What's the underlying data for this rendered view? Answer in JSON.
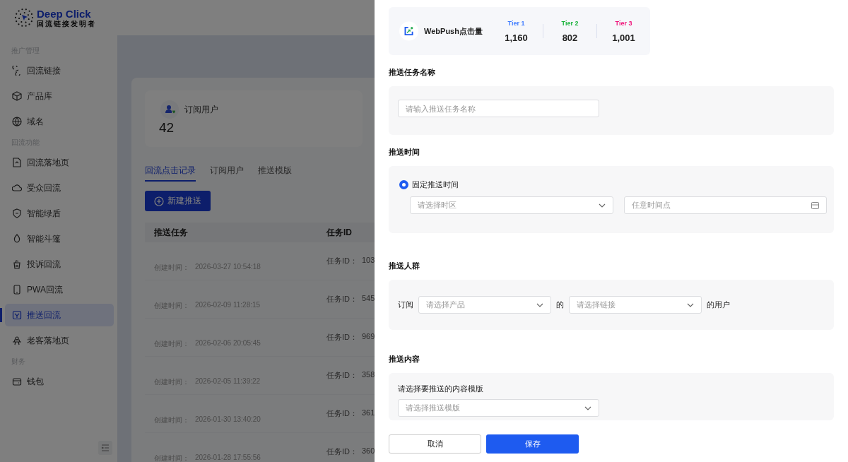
{
  "logo": {
    "name": "Deep Click",
    "tagline": "回流链接发明者"
  },
  "sidebar": {
    "sections": [
      {
        "title": "推广管理",
        "items": [
          {
            "label": "回流链接",
            "selected": false
          },
          {
            "label": "产品库",
            "selected": false
          },
          {
            "label": "域名",
            "selected": false
          }
        ]
      },
      {
        "title": "回流功能",
        "items": [
          {
            "label": "回流落地页",
            "selected": false
          },
          {
            "label": "受众回流",
            "selected": false
          },
          {
            "label": "智能绿盾",
            "selected": false
          },
          {
            "label": "智能斗篷",
            "selected": false
          },
          {
            "label": "投诉回流",
            "selected": false
          },
          {
            "label": "PWA回流",
            "selected": false
          },
          {
            "label": "推送回流",
            "selected": true
          },
          {
            "label": "老客落地页",
            "selected": false
          }
        ]
      },
      {
        "title": "财务",
        "items": [
          {
            "label": "钱包",
            "selected": false
          }
        ]
      }
    ]
  },
  "stat": {
    "label": "订阅用户",
    "value": "42"
  },
  "tabs": [
    {
      "label": "回流点击记录",
      "selected": true
    },
    {
      "label": "订阅用户",
      "selected": false
    },
    {
      "label": "推送模版",
      "selected": false
    }
  ],
  "new_button": "新建推送",
  "table": {
    "columns": [
      "推送任务",
      "任务ID"
    ],
    "rows": [
      {
        "created_label": "创建时间：",
        "created": "2026-03-27 10:54:18",
        "id_label": "任务ID：",
        "id": "103"
      },
      {
        "created_label": "创建时间：",
        "created": "2026-02-09 11:28:15",
        "id_label": "任务ID：",
        "id": "545"
      },
      {
        "created_label": "创建时间：",
        "created": "2026-02-06 20:05:45",
        "id_label": "任务ID：",
        "id": "969"
      },
      {
        "created_label": "创建时间：",
        "created": "2026-02-05 11:39:22",
        "id_label": "任务ID：",
        "id": "358"
      },
      {
        "created_label": "创建时间：",
        "created": "2026-01-30 13:40:20",
        "id_label": "任务ID：",
        "id": "361"
      },
      {
        "created_label": "创建时间：",
        "created": "2026-01-28 17:55:56",
        "id_label": "任务ID：",
        "id": "360"
      }
    ]
  },
  "drawer": {
    "summary": {
      "title": "WebPush点击量",
      "tiers": [
        {
          "label": "Tier 1",
          "value": "1,160",
          "color": "#3d7bff"
        },
        {
          "label": "Tier 2",
          "value": "802",
          "color": "#19b23b"
        },
        {
          "label": "Tier 3",
          "value": "1,001",
          "color": "#f0157a"
        }
      ]
    },
    "sections": [
      {
        "kind": "name",
        "title": "推送任务名称",
        "placeholder": "请输入推送任务名称"
      },
      {
        "kind": "time",
        "title": "推送时间",
        "option": {
          "label": "固定推送时间",
          "selected": true
        },
        "timezone_placeholder": "请选择时区",
        "time_placeholder": "任意时间点"
      },
      {
        "kind": "audience",
        "title": "推送人群",
        "prefix": "订阅",
        "product_placeholder": "请选择产品",
        "middle": "的",
        "link_placeholder": "请选择链接",
        "suffix": "的用户"
      },
      {
        "kind": "content",
        "title": "推送内容",
        "label": "请选择要推送的内容模版",
        "placeholder": "请选择推送模版"
      }
    ],
    "cancel_button": "取消",
    "save_button": "保存"
  }
}
